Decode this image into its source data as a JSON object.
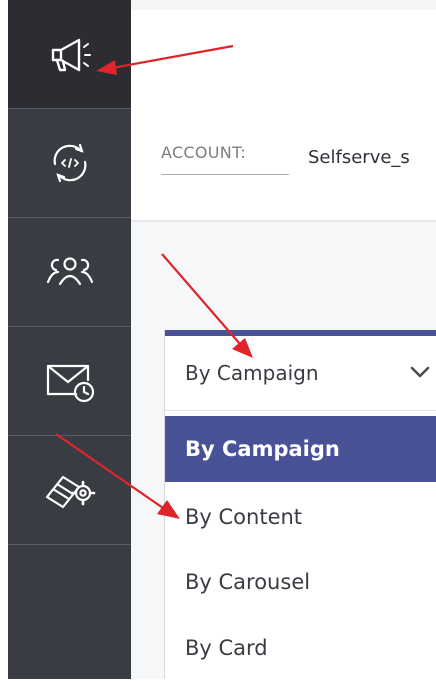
{
  "account": {
    "label": "ACCOUNT:",
    "value": "Selfserve_s"
  },
  "dropdown": {
    "selected": "By Campaign",
    "options": [
      "By Campaign",
      "By Content",
      "By Carousel",
      "By Card"
    ],
    "highlighted_index": 0
  },
  "sidebar": {
    "items": [
      {
        "icon": "megaphone-icon"
      },
      {
        "icon": "code-sync-icon"
      },
      {
        "icon": "users-icon"
      },
      {
        "icon": "mail-clock-icon"
      },
      {
        "icon": "card-settings-icon"
      }
    ]
  },
  "colors": {
    "sidebar": "#3a3c44",
    "accent": "#4a5297",
    "annotation_arrow": "#e0242b"
  }
}
